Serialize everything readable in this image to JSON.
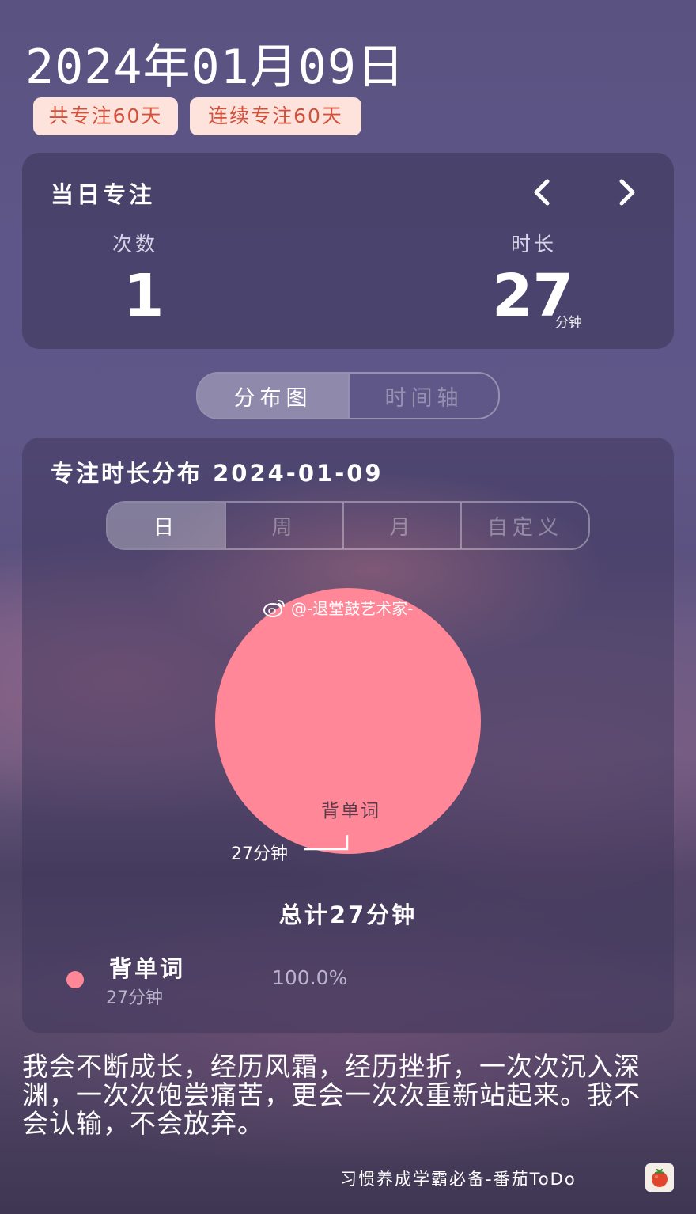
{
  "header": {
    "date_title": "2024年01月09日",
    "badge_total": "共专注60天",
    "badge_streak": "连续专注60天"
  },
  "daily": {
    "title": "当日专注",
    "count_label": "次数",
    "count_value": "1",
    "duration_label": "时长",
    "duration_value": "27",
    "duration_unit": "分钟"
  },
  "view_switch": {
    "options": [
      "分布图",
      "时间轴"
    ],
    "active": "分布图"
  },
  "distribution": {
    "title": "专注时长分布 2024-01-09",
    "period_tabs": [
      "日",
      "周",
      "月",
      "自定义"
    ],
    "active_tab": "日",
    "watermark": "@-退堂鼓艺术家-",
    "total_text": "总计27分钟"
  },
  "chart_data": {
    "type": "pie",
    "title": "",
    "categories": [
      "背单词"
    ],
    "values": [
      27
    ],
    "value_labels": [
      "27分钟"
    ],
    "percent_labels": [
      "100.0%"
    ],
    "colors": [
      "#ff8797"
    ]
  },
  "legend": [
    {
      "name": "背单词",
      "sub": "27分钟",
      "percent": "100.0%",
      "color": "#ff8797"
    }
  ],
  "quote": "我会不断成长，经历风霜，经历挫折，一次次沉入深渊，一次次饱尝痛苦，更会一次次重新站起来。我不会认输，不会放弃。",
  "footer": {
    "text": "习惯养成学霸必备-番茄ToDo",
    "app_icon": "tomato-icon"
  }
}
